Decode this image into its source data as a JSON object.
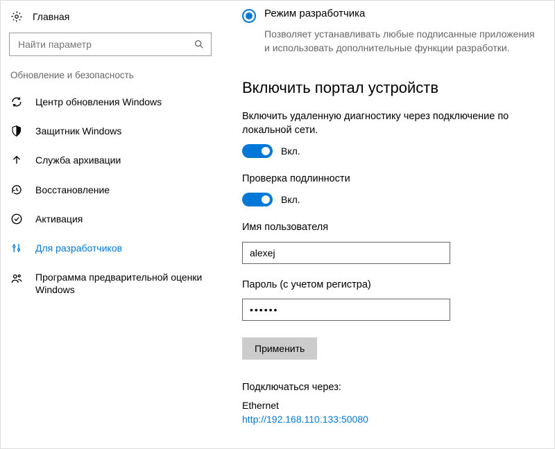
{
  "sidebar": {
    "home": "Главная",
    "search_placeholder": "Найти параметр",
    "section": "Обновление и безопасность",
    "items": [
      {
        "label": "Центр обновления Windows"
      },
      {
        "label": "Защитник Windows"
      },
      {
        "label": "Служба архивации"
      },
      {
        "label": "Восстановление"
      },
      {
        "label": "Активация"
      },
      {
        "label": "Для разработчиков"
      },
      {
        "label": "Программа предварительной оценки Windows"
      }
    ]
  },
  "main": {
    "radio_label": "Режим разработчика",
    "radio_desc": "Позволяет устанавливать любые подписанные приложения и использовать дополнительные функции разработки.",
    "portal_title": "Включить портал устройств",
    "remote_diag_label": "Включить удаленную диагностику через подключение по локальной сети.",
    "remote_diag_state": "Вкл.",
    "auth_label": "Проверка подлинности",
    "auth_state": "Вкл.",
    "username_label": "Имя пользователя",
    "username_value": "alexej",
    "password_label": "Пароль (с учетом регистра)",
    "password_masked": "••••••",
    "apply_btn": "Применить",
    "connect_label": "Подключаться через:",
    "connect_iface": "Ethernet",
    "connect_url": "http://192.168.110.133:50080"
  }
}
